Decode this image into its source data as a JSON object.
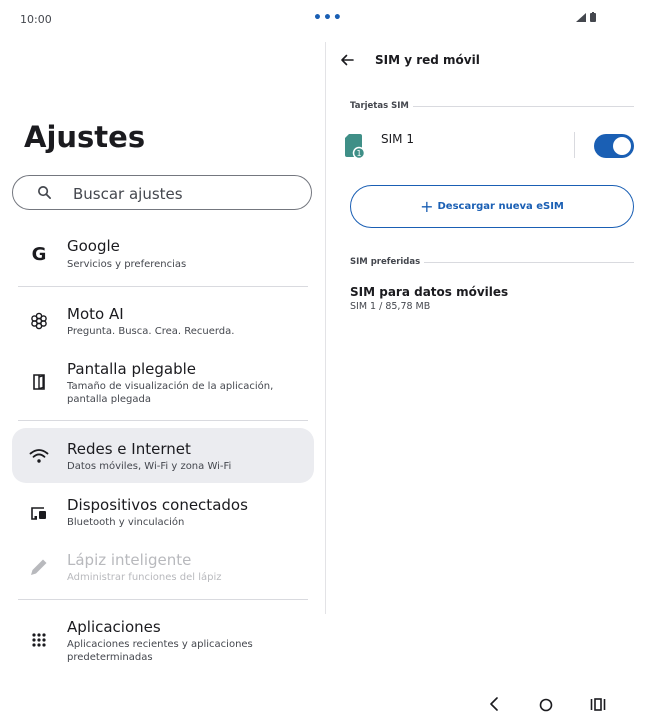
{
  "status_bar": {
    "time": "10:00",
    "dots": "•••"
  },
  "left_pane": {
    "title": "Ajustes",
    "search": {
      "placeholder": "Buscar ajustes"
    },
    "items": [
      {
        "title": "Google",
        "subtitle": "Servicios y preferencias",
        "icon": "google-icon"
      },
      {
        "title": "Moto AI",
        "subtitle": "Pregunta. Busca. Crea. Recuerda.",
        "icon": "moto-ai-icon"
      },
      {
        "title": "Pantalla plegable",
        "subtitle": "Tamaño de visualización de la aplicación, pantalla plegada",
        "icon": "foldable-icon"
      },
      {
        "title": "Redes e Internet",
        "subtitle": "Datos móviles, Wi-Fi y zona Wi-Fi",
        "icon": "wifi-icon",
        "selected": true
      },
      {
        "title": "Dispositivos conectados",
        "subtitle": "Bluetooth y vinculación",
        "icon": "devices-icon"
      },
      {
        "title": "Lápiz inteligente",
        "subtitle": "Administrar funciones del lápiz",
        "icon": "pen-icon",
        "disabled": true
      },
      {
        "title": "Aplicaciones",
        "subtitle": "Aplicaciones recientes y aplicaciones predeterminadas",
        "icon": "apps-grid-icon"
      }
    ]
  },
  "right_pane": {
    "title": "SIM y red móvil",
    "section_sim": "Tarjetas SIM",
    "sim": {
      "label": "SIM 1",
      "badge": "1",
      "enabled": true
    },
    "download_esim": "Descargar nueva eSIM",
    "download_plus": "+",
    "section_preferred": "SIM preferidas",
    "data_sim": {
      "title": "SIM para datos móviles",
      "subtitle": "SIM 1 / 85,78 MB"
    }
  },
  "colors": {
    "accent": "#1a5fb4",
    "sim_icon": "#3f8f87",
    "selected_bg": "#ebecf0"
  }
}
